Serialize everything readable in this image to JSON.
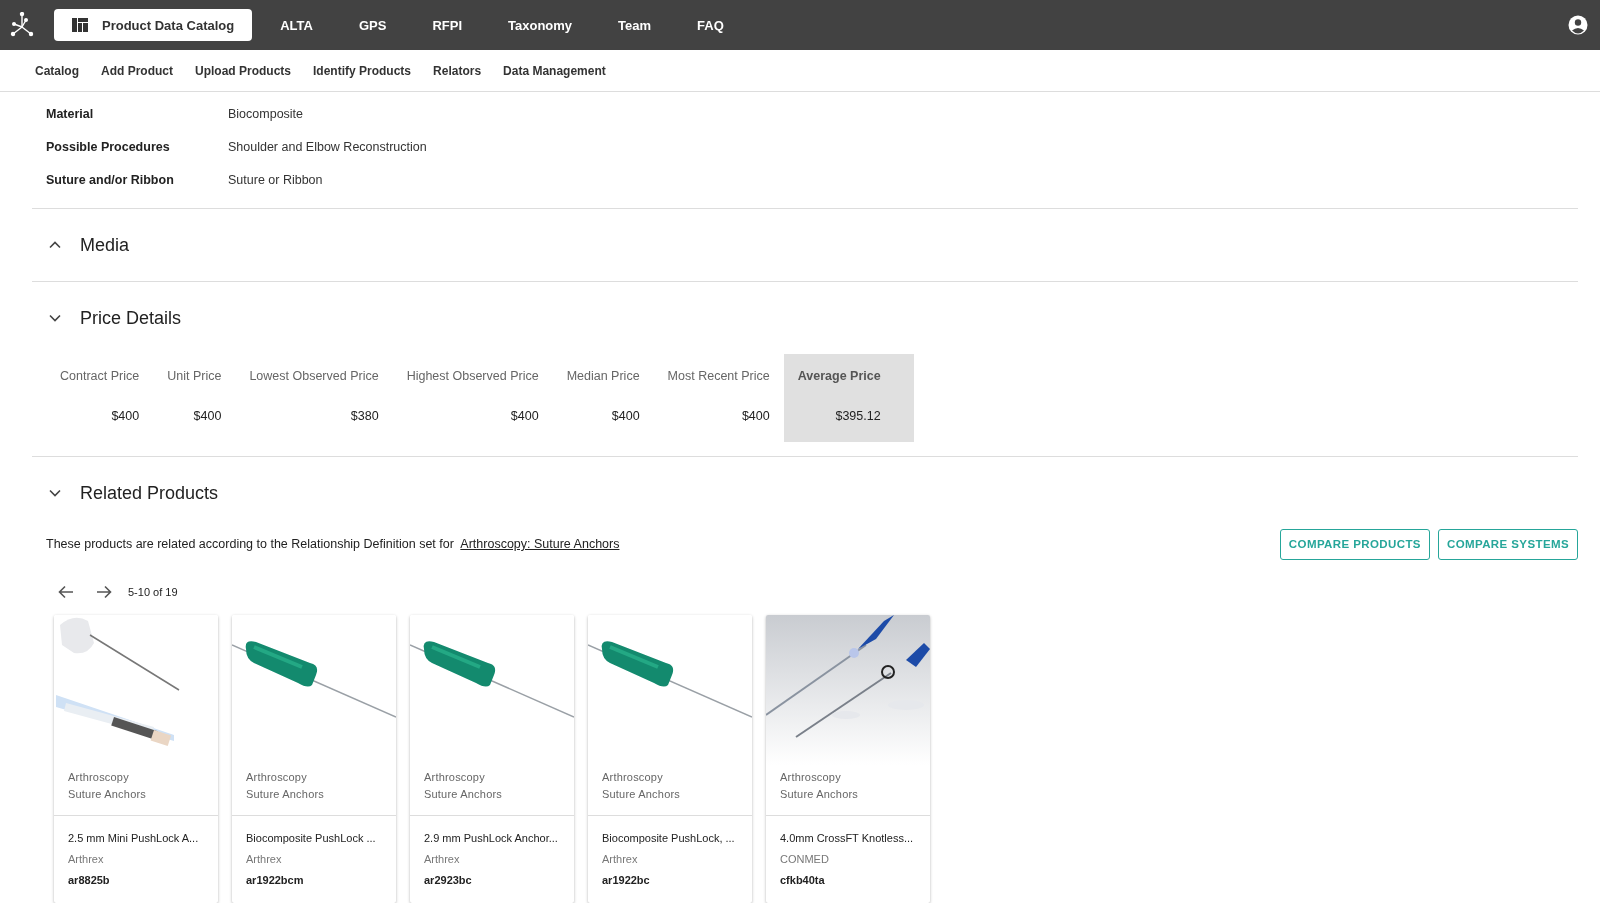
{
  "topbar": {
    "tabs": [
      {
        "label": "Product Data Catalog",
        "selected": true
      },
      {
        "label": "ALTA",
        "selected": false
      },
      {
        "label": "GPS",
        "selected": false
      },
      {
        "label": "RFPI",
        "selected": false
      },
      {
        "label": "Taxonomy",
        "selected": false
      },
      {
        "label": "Team",
        "selected": false
      },
      {
        "label": "FAQ",
        "selected": false
      }
    ]
  },
  "subnav": [
    "Catalog",
    "Add Product",
    "Upload Products",
    "Identify Products",
    "Relators",
    "Data Management"
  ],
  "attributes": [
    {
      "label": "Material",
      "value": "Biocomposite"
    },
    {
      "label": "Possible Procedures",
      "value": "Shoulder and Elbow Reconstruction"
    },
    {
      "label": "Suture and/or Ribbon",
      "value": "Suture or Ribbon"
    }
  ],
  "media": {
    "title": "Media",
    "expanded": false
  },
  "price_details": {
    "title": "Price Details",
    "expanded": true,
    "columns": [
      {
        "label": "Contract Price",
        "value": "$400",
        "highlighted": false
      },
      {
        "label": "Unit Price",
        "value": "$400",
        "highlighted": false
      },
      {
        "label": "Lowest Observed Price",
        "value": "$380",
        "highlighted": false
      },
      {
        "label": "Highest Observed Price",
        "value": "$400",
        "highlighted": false
      },
      {
        "label": "Median Price",
        "value": "$400",
        "highlighted": false
      },
      {
        "label": "Most Recent Price",
        "value": "$400",
        "highlighted": false
      },
      {
        "label": "Average Price",
        "value": "$395.12",
        "highlighted": true
      }
    ]
  },
  "related_products": {
    "title": "Related Products",
    "expanded": true,
    "description": "These products are related according to the Relationship Definition set for",
    "link": "Arthroscopy: Suture Anchors",
    "buttons": [
      "COMPARE PRODUCTS",
      "COMPARE SYSTEMS"
    ],
    "range": "5-10 of 19",
    "cards": [
      {
        "category": "Arthroscopy",
        "subcategory": "Suture Anchors",
        "name": "2.5 mm Mini PushLock A...",
        "manufacturer": "Arthrex",
        "code": "ar8825b"
      },
      {
        "category": "Arthroscopy",
        "subcategory": "Suture Anchors",
        "name": "Biocomposite PushLock ...",
        "manufacturer": "Arthrex",
        "code": "ar1922bcm"
      },
      {
        "category": "Arthroscopy",
        "subcategory": "Suture Anchors",
        "name": "2.9 mm PushLock Anchor...",
        "manufacturer": "Arthrex",
        "code": "ar2923bc"
      },
      {
        "category": "Arthroscopy",
        "subcategory": "Suture Anchors",
        "name": "Biocomposite PushLock, ...",
        "manufacturer": "Arthrex",
        "code": "ar1922bc"
      },
      {
        "category": "Arthroscopy",
        "subcategory": "Suture Anchors",
        "name": "4.0mm CrossFT Knotless...",
        "manufacturer": "CONMED",
        "code": "cfkb40ta"
      }
    ]
  }
}
